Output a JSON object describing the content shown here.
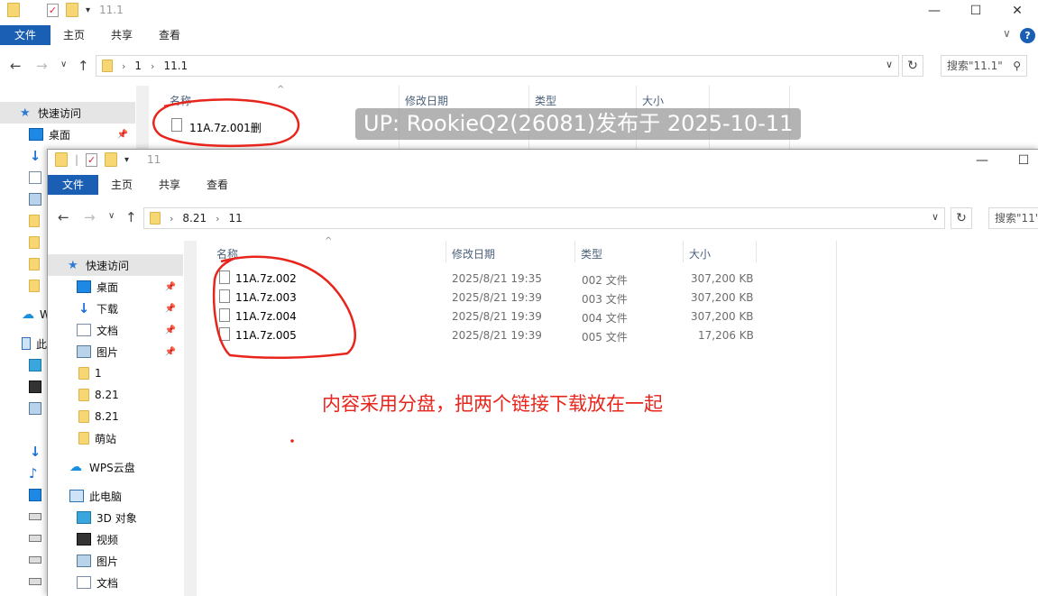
{
  "back_window": {
    "title": "11.1",
    "ribbon_tabs": [
      "文件",
      "主页",
      "共享",
      "查看"
    ],
    "breadcrumb": [
      "1",
      "11.1"
    ],
    "search_placeholder": "搜索\"11.1\"",
    "columns": [
      "名称",
      "修改日期",
      "类型",
      "大小"
    ],
    "sidebar": {
      "quick_access": "快速访问",
      "desktop": "桌面",
      "partial_labels": [
        "W",
        "此"
      ]
    },
    "files": [
      {
        "name": "11A.7z.001删"
      }
    ]
  },
  "front_window": {
    "title": "11",
    "ribbon_tabs": [
      "文件",
      "主页",
      "共享",
      "查看"
    ],
    "breadcrumb": [
      "8.21",
      "11"
    ],
    "search_placeholder": "搜索\"11\"",
    "columns": [
      "名称",
      "修改日期",
      "类型",
      "大小"
    ],
    "sidebar": {
      "quick_access": "快速访问",
      "pinned": [
        {
          "label": "桌面",
          "icon": "desktop-icon"
        },
        {
          "label": "下载",
          "icon": "download-icon"
        },
        {
          "label": "文档",
          "icon": "documents-icon"
        },
        {
          "label": "图片",
          "icon": "pictures-icon"
        }
      ],
      "folders": [
        "1",
        "8.21",
        "8.21",
        "萌站"
      ],
      "wps_cloud": "WPS云盘",
      "this_pc": "此电脑",
      "pc_items": [
        {
          "label": "3D 对象",
          "icon": "3d-objects-icon"
        },
        {
          "label": "视频",
          "icon": "videos-icon"
        },
        {
          "label": "图片",
          "icon": "pictures-icon"
        },
        {
          "label": "文档",
          "icon": "documents-icon"
        }
      ]
    },
    "files": [
      {
        "name": "11A.7z.002",
        "date": "2025/8/21 19:35",
        "type": "002 文件",
        "size": "307,200 KB"
      },
      {
        "name": "11A.7z.003",
        "date": "2025/8/21 19:39",
        "type": "003 文件",
        "size": "307,200 KB"
      },
      {
        "name": "11A.7z.004",
        "date": "2025/8/21 19:39",
        "type": "004 文件",
        "size": "307,200 KB"
      },
      {
        "name": "11A.7z.005",
        "date": "2025/8/21 19:39",
        "type": "005 文件",
        "size": "17,206 KB"
      }
    ]
  },
  "overlays": {
    "uploader_watermark": "UP: RookieQ2(26081)发布于 2025-10-11",
    "note": "内容采用分盘，把两个链接下载放在一起"
  },
  "colors": {
    "accent": "#1a5fb4",
    "annotation": "#e8251c"
  }
}
